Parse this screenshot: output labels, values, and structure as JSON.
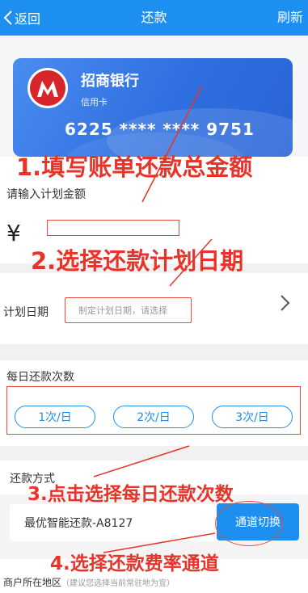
{
  "header": {
    "back_label": "返回",
    "title": "还款",
    "refresh_label": "刷新"
  },
  "card": {
    "bank_name": "招商银行",
    "card_type": "信用卡",
    "card_number": "6225 **** **** 9751"
  },
  "amount": {
    "label": "请输入计划金额",
    "currency_symbol": "¥",
    "value": ""
  },
  "plan_date": {
    "label": "计划日期",
    "placeholder": "制定计划日期，请选择"
  },
  "frequency": {
    "label": "每日还款次数",
    "options": [
      "1次/日",
      "2次/日",
      "3次/日"
    ]
  },
  "method": {
    "label": "还款方式",
    "value": "最优智能还款-A8127",
    "switch_label": "通道切换"
  },
  "region": {
    "label": "商户所在地区",
    "hint": "（建议您选择当前常驻地为宜）"
  },
  "annotations": [
    "1.填写账单还款总金额",
    "2.选择还款计划日期",
    "3.点击选择每日还款次数",
    "4.选择还款费率通道"
  ],
  "colors": {
    "header_blue": "#1d8ff0",
    "annotation_red": "#e8332a",
    "card_blue": "#3a78e6"
  }
}
